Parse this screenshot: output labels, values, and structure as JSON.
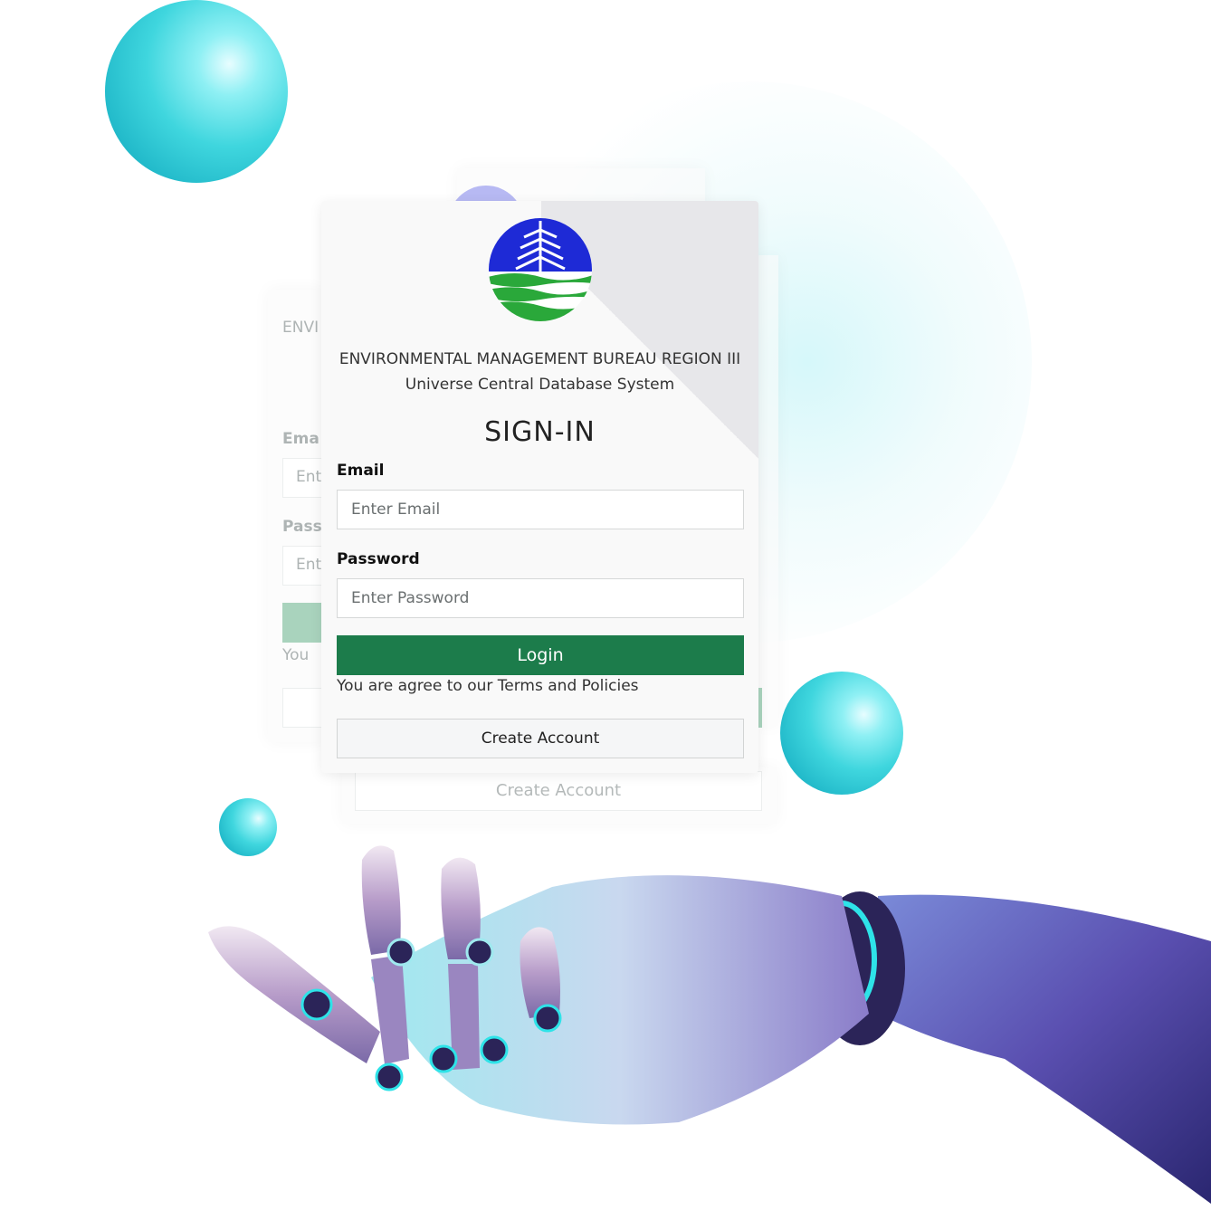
{
  "org": {
    "name": "ENVIRONMENTAL MANAGEMENT BUREAU REGION III",
    "system": "Universe Central Database System"
  },
  "form": {
    "title": "SIGN-IN",
    "email_label": "Email",
    "email_placeholder": "Enter Email",
    "password_label": "Password",
    "password_placeholder": "Enter Password",
    "login_label": "Login",
    "terms_text": "You are agree to our Terms and Policies",
    "create_account_label": "Create Account"
  },
  "ghost": {
    "org_fragment": "ENVI",
    "email_fragment": "Ema",
    "email_input_fragment": "Ent",
    "password_fragment": "Pass",
    "password_input_fragment": "Ent",
    "terms_fragment": "You",
    "create_account_label": "Create Account"
  },
  "colors": {
    "login_button": "#1c7c4b",
    "logo_blue": "#1e2ad6",
    "logo_green": "#2aa83a",
    "sphere": "#3fd6de"
  },
  "icons": {
    "logo": "emb-denr-logo",
    "hand": "robotic-hand-illustration"
  }
}
